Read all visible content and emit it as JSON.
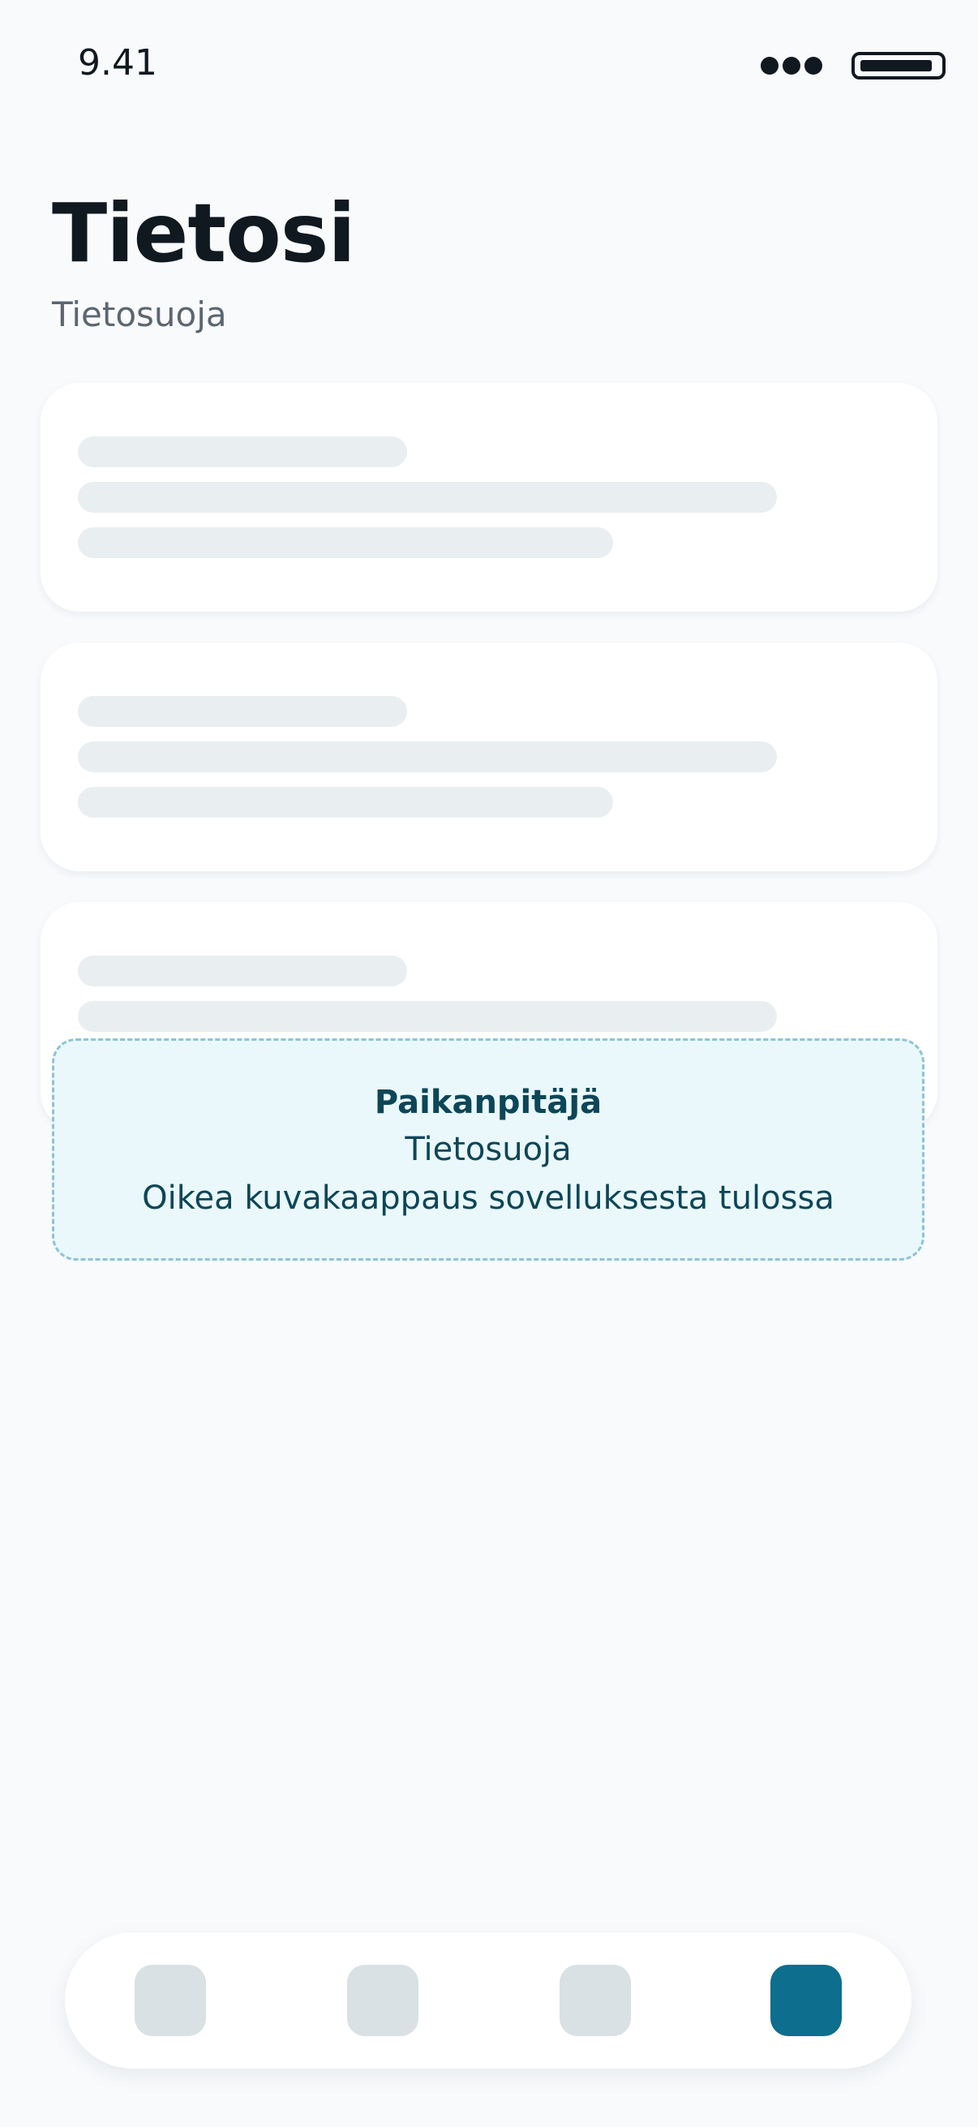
{
  "status_bar": {
    "time": "9.41"
  },
  "header": {
    "title": "Tietosi",
    "subtitle": "Tietosuoja"
  },
  "placeholder": {
    "title": "Paikanpitäjä",
    "line1": "Tietosuoja",
    "line2": "Oikea kuvakaappaus sovelluksesta tulossa"
  },
  "tabbar": {
    "tabs": [
      {
        "state": "inactive"
      },
      {
        "state": "inactive"
      },
      {
        "state": "inactive"
      },
      {
        "state": "active"
      }
    ]
  },
  "colors": {
    "background": "#f8fafc",
    "active_tab": "#0d6e8d",
    "inactive_tab": "#d9e1e5",
    "placeholder_border": "#8ec3d6",
    "placeholder_bg": "#eaf8fb",
    "placeholder_text": "#0c4658"
  }
}
